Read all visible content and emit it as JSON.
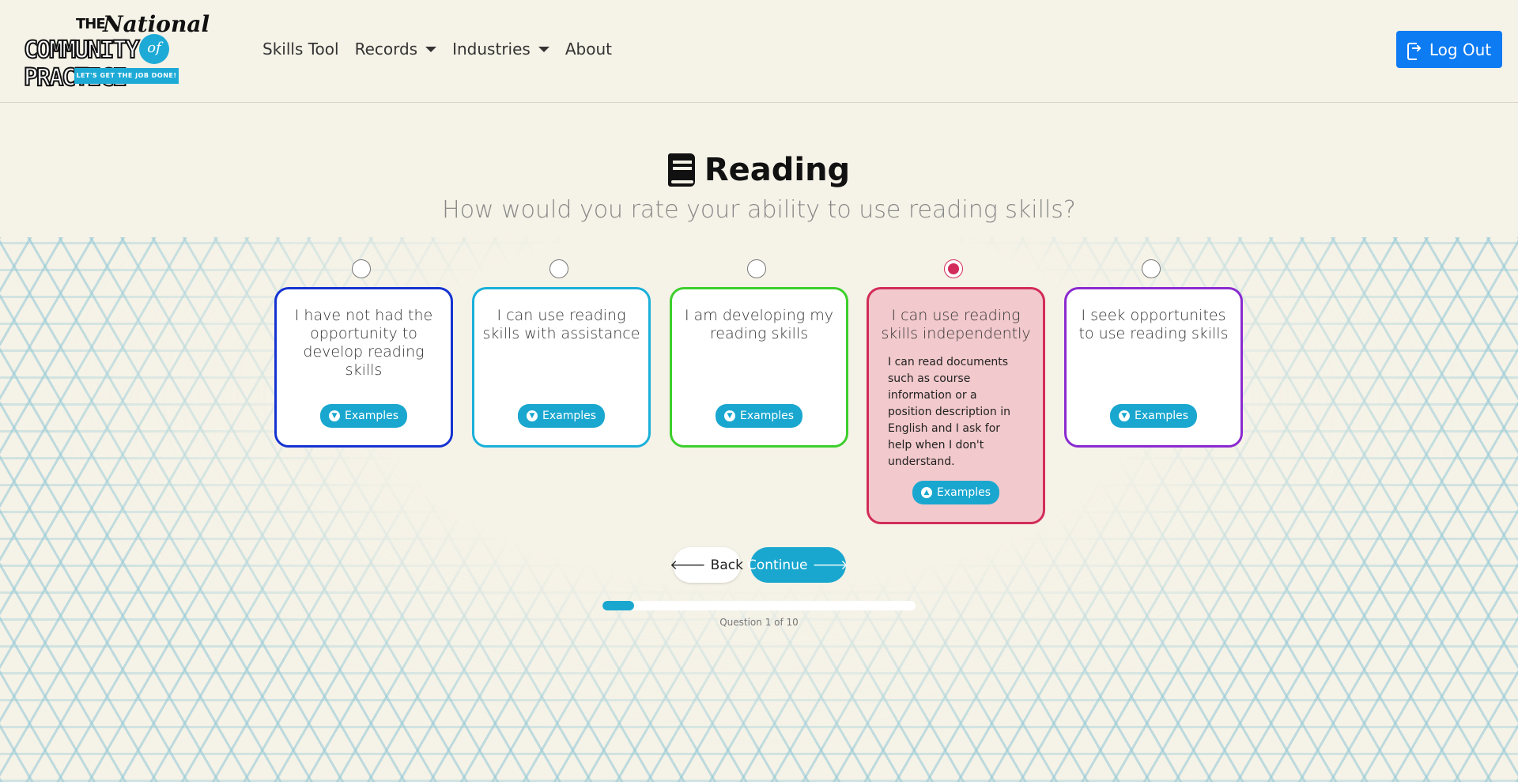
{
  "header": {
    "logo": {
      "the": "THE",
      "national": "National",
      "community": "COMMUNITY PRACTICE",
      "of": "of",
      "tagline": "LET'S GET THE JOB DONE!"
    },
    "nav": [
      {
        "label": "Skills Tool",
        "dropdown": false
      },
      {
        "label": "Records",
        "dropdown": true
      },
      {
        "label": "Industries",
        "dropdown": true
      },
      {
        "label": "About",
        "dropdown": false
      }
    ],
    "logout_label": "Log Out",
    "logout_color": "#0d7bf2"
  },
  "question": {
    "icon": "book-icon",
    "title": "Reading",
    "prompt": "How would you rate your ability to use reading skills?",
    "selected_index": 3,
    "options": [
      {
        "label": "I have not had the opportunity to develop reading skills",
        "color": "#1533d1",
        "example_label": "Examples",
        "expanded": false,
        "description": ""
      },
      {
        "label": "I can use reading skills with assistance",
        "color": "#1ab0d9",
        "example_label": "Examples",
        "expanded": false,
        "description": ""
      },
      {
        "label": "I am developing my reading skills",
        "color": "#3ccf2c",
        "example_label": "Examples",
        "expanded": false,
        "description": ""
      },
      {
        "label": "I can use reading skills independently",
        "color": "#d22c5a",
        "example_label": "Examples",
        "expanded": true,
        "description": "I can read documents such as course information or a position description in English and I ask for help when I don't understand."
      },
      {
        "label": "I seek opportunites to use reading skills",
        "color": "#8a2ad0",
        "example_label": "Examples",
        "expanded": false,
        "description": ""
      }
    ]
  },
  "actions": {
    "back_label": "Back",
    "continue_label": "Continue"
  },
  "progress": {
    "current": 1,
    "total": 10,
    "fraction": 0.1,
    "label": "Question 1 of 10"
  }
}
